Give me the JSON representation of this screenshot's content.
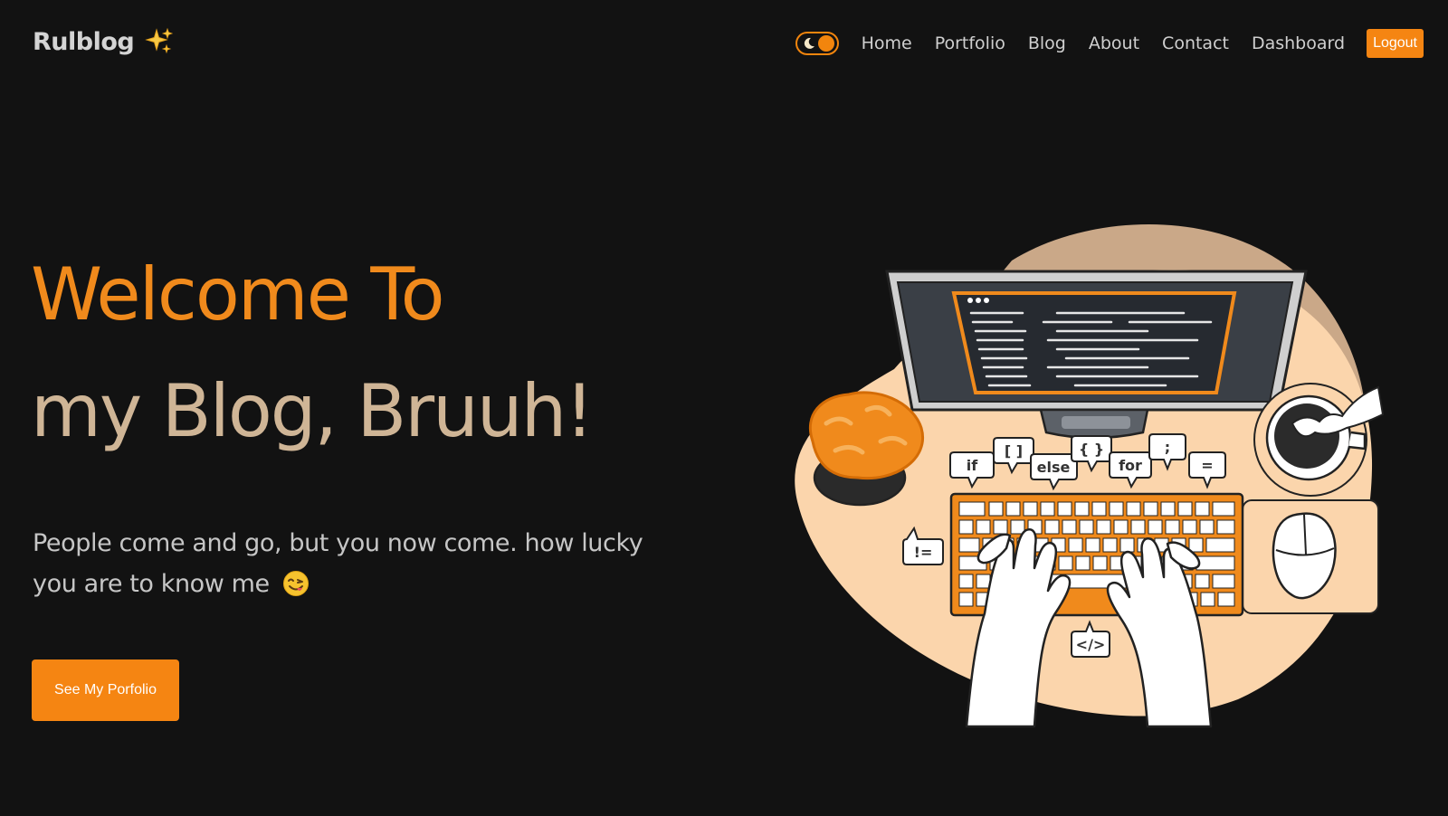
{
  "brand": {
    "name": "Rulblog",
    "icon": "sparkles-icon"
  },
  "nav": {
    "theme_toggle_icon": "moon-icon",
    "links": [
      "Home",
      "Portfolio",
      "Blog",
      "About",
      "Contact",
      "Dashboard"
    ],
    "logout_label": "Logout"
  },
  "hero": {
    "title_line1": "Welcome To",
    "title_line2": "my Blog, Bruuh!",
    "subtitle": "People come and go, but you now come. how lucky you are to know me",
    "subtitle_emoji": "face-savoring-food-icon",
    "cta_label": "See My Porfolio"
  },
  "illustration": {
    "code_bubbles": [
      "if",
      "[ ]",
      "else",
      "{ }",
      "for",
      ";",
      "=",
      "!=",
      "</>"
    ]
  },
  "colors": {
    "background": "#121212",
    "accent": "#f58512",
    "title_orange": "#f08a1c",
    "title_beige": "#cfb596",
    "blob_light": "#fbd5ac",
    "blob_dark": "#caa888"
  }
}
